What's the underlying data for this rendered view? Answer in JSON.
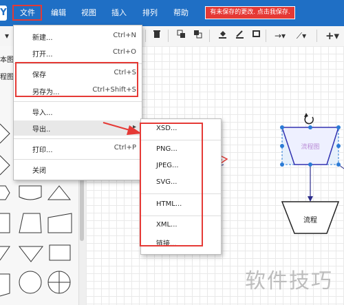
{
  "menubar": {
    "logo": "Y",
    "items": [
      "文件",
      "编辑",
      "视图",
      "插入",
      "排列",
      "帮助"
    ],
    "unsaved_notice": "有未保存的更改. 点击我保存."
  },
  "left_panel": {
    "labels": [
      "本图",
      "程图"
    ]
  },
  "file_menu": {
    "new": {
      "label": "新建...",
      "shortcut": "Ctrl+N"
    },
    "open": {
      "label": "打开...",
      "shortcut": "Ctrl+O"
    },
    "save": {
      "label": "保存",
      "shortcut": "Ctrl+S"
    },
    "save_as": {
      "label": "另存为...",
      "shortcut": "Ctrl+Shift+S"
    },
    "import": {
      "label": "导入..."
    },
    "export": {
      "label": "导出..",
      "arrow": "▸"
    },
    "print": {
      "label": "打印...",
      "shortcut": "Ctrl+P"
    },
    "close": {
      "label": "关闭"
    }
  },
  "export_menu": [
    "XSD...",
    "PNG...",
    "JPEG...",
    "SVG...",
    "HTML...",
    "XML...",
    "链接..."
  ],
  "canvas": {
    "selected_shape_label": "流程图",
    "shape_label": "流程"
  },
  "watermark": "软件技巧",
  "colors": {
    "menubar": "#1f6fc5",
    "highlight": "#e53935",
    "selection": "#2b7bd6"
  },
  "toolbar_icons": [
    "dropdown-icon",
    "delete-icon",
    "to-front-icon",
    "to-back-icon",
    "fill-color-icon",
    "line-color-icon",
    "shadow-icon",
    "connection-icon",
    "waypoint-icon",
    "insert-icon"
  ]
}
